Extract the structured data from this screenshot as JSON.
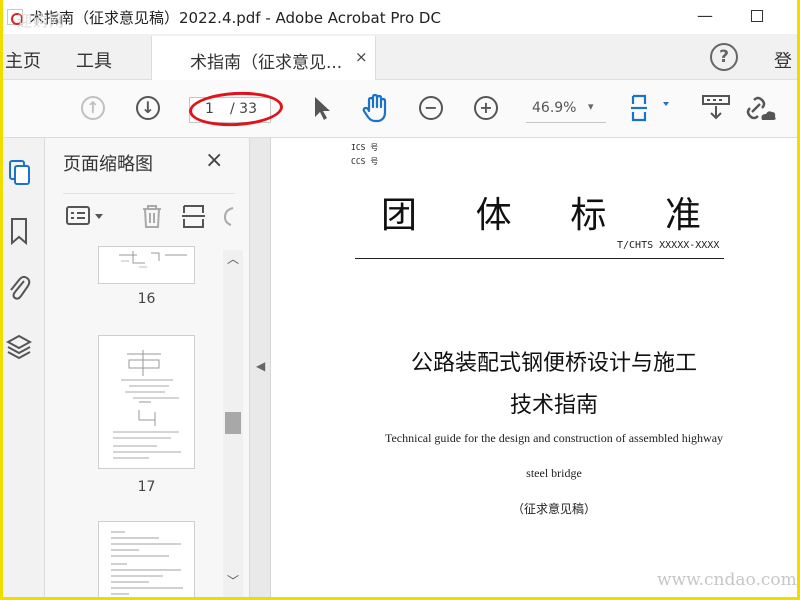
{
  "window": {
    "title": "术指南（征求意见稿）2022.4.pdf - Adobe Acrobat Pro DC",
    "minimize_glyph": "—",
    "watermark_top": "迎购网",
    "watermark_bottom": "www.cndao.com"
  },
  "tabs": {
    "home": "主页",
    "tools": "工具",
    "document": "术指南（征求意见...",
    "close_glyph": "×",
    "help_glyph": "?",
    "login": "登"
  },
  "toolbar": {
    "page_current": "1",
    "page_total": "/ 33",
    "zoom": "46.9%",
    "zoom_caret": "▾",
    "icons": [
      "arrow-up-icon",
      "arrow-down-icon",
      "select-cursor-icon",
      "hand-tool-icon",
      "zoom-out-icon",
      "zoom-in-icon",
      "page-fit-icon",
      "page-display-icon",
      "share-link-icon"
    ]
  },
  "sidebar": {
    "rail_icons": [
      "page-thumbnails-icon",
      "bookmarks-icon",
      "attachments-icon",
      "layers-icon"
    ],
    "panel_title": "页面缩略图",
    "panel_close": "×",
    "thumbnails": [
      {
        "label": "16"
      },
      {
        "label": "17"
      },
      {
        "label": ""
      }
    ]
  },
  "document": {
    "ics": "ICS 号",
    "ccs": "CCS 号",
    "standard_chars": [
      "团",
      "体",
      "标",
      "准"
    ],
    "code": "T/CHTS XXXXX-XXXX",
    "title_cn_line1": "公路装配式钢便桥设计与施工",
    "title_cn_line2": "技术指南",
    "title_en_line1": "Technical guide for the design and construction of assembled highway",
    "title_en_line2": "steel bridge",
    "draft_note": "（征求意见稿）"
  },
  "colors": {
    "highlight_ellipse": "#e0121a",
    "frame_border": "#f0dd00",
    "hand_tool": "#1a73c9"
  }
}
